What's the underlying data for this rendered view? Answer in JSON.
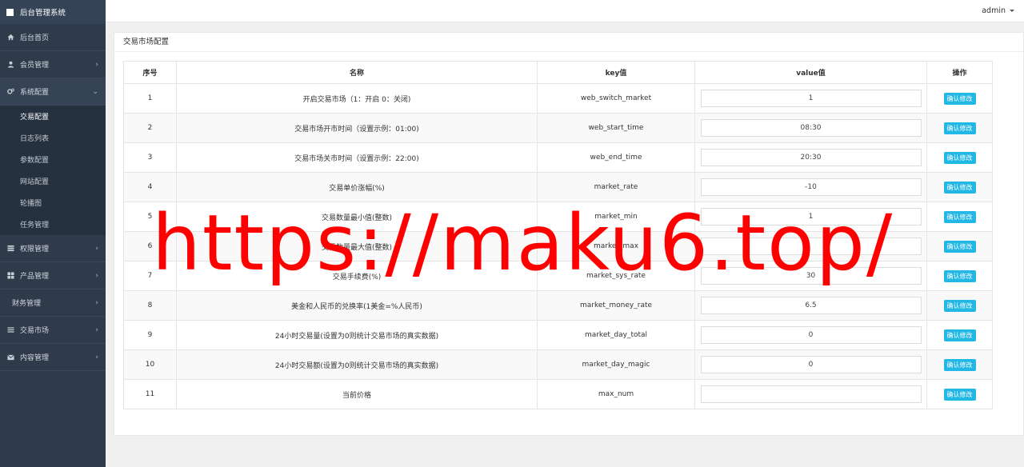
{
  "app": {
    "title": "后台管理系统"
  },
  "sidebar": {
    "items": [
      {
        "label": "后台首页",
        "icon": "home-icon",
        "chevron": false
      },
      {
        "label": "会员管理",
        "icon": "user-icon",
        "chevron": true
      },
      {
        "label": "系统配置",
        "icon": "gears-icon",
        "chevron": true,
        "open": true,
        "children": [
          "交易配置",
          "日志列表",
          "参数配置",
          "网站配置",
          "轮播图",
          "任务管理"
        ]
      },
      {
        "label": "权限管理",
        "icon": "list-icon",
        "chevron": true
      },
      {
        "label": "产品管理",
        "icon": "windows-icon",
        "chevron": true
      },
      {
        "label": "财务管理",
        "icon": "",
        "chevron": true
      },
      {
        "label": "交易市场",
        "icon": "bars-icon",
        "chevron": true
      },
      {
        "label": "内容管理",
        "icon": "envelope-icon",
        "chevron": true
      }
    ]
  },
  "topbar": {
    "user": "admin"
  },
  "panel": {
    "title": "交易市场配置"
  },
  "table": {
    "headers": [
      "序号",
      "名称",
      "key值",
      "value值",
      "操作"
    ],
    "button_label": "确认修改",
    "rows": [
      {
        "id": "1",
        "name": "开启交易市场（1：开启 0：关闭)",
        "key": "web_switch_market",
        "value": "1"
      },
      {
        "id": "2",
        "name": "交易市场开市时间（设置示例：01:00)",
        "key": "web_start_time",
        "value": "08:30"
      },
      {
        "id": "3",
        "name": "交易市场关市时间（设置示例：22:00)",
        "key": "web_end_time",
        "value": "20:30"
      },
      {
        "id": "4",
        "name": "交易单价涨幅(%)",
        "key": "market_rate",
        "value": "-10"
      },
      {
        "id": "5",
        "name": "交易数量最小值(整数)",
        "key": "market_min",
        "value": "1"
      },
      {
        "id": "6",
        "name": "交易数量最大值(整数)",
        "key": "market_max",
        "value": ""
      },
      {
        "id": "7",
        "name": "交易手续费(%)",
        "key": "market_sys_rate",
        "value": "30"
      },
      {
        "id": "8",
        "name": "美金和人民币的兑换率(1美金=%人民币)",
        "key": "market_money_rate",
        "value": "6.5"
      },
      {
        "id": "9",
        "name": "24小时交易量(设置为0则统计交易市场的真实数据)",
        "key": "market_day_total",
        "value": "0"
      },
      {
        "id": "10",
        "name": "24小时交易额(设置为0则统计交易市场的真实数据)",
        "key": "market_day_magic",
        "value": "0"
      },
      {
        "id": "11",
        "name": "当前价格",
        "key": "max_num",
        "value": ""
      }
    ]
  },
  "watermark": "https://maku6.top/",
  "colors": {
    "sidebar": "#2f3a4a",
    "button": "#23b7e5",
    "watermark": "#ff0000"
  }
}
